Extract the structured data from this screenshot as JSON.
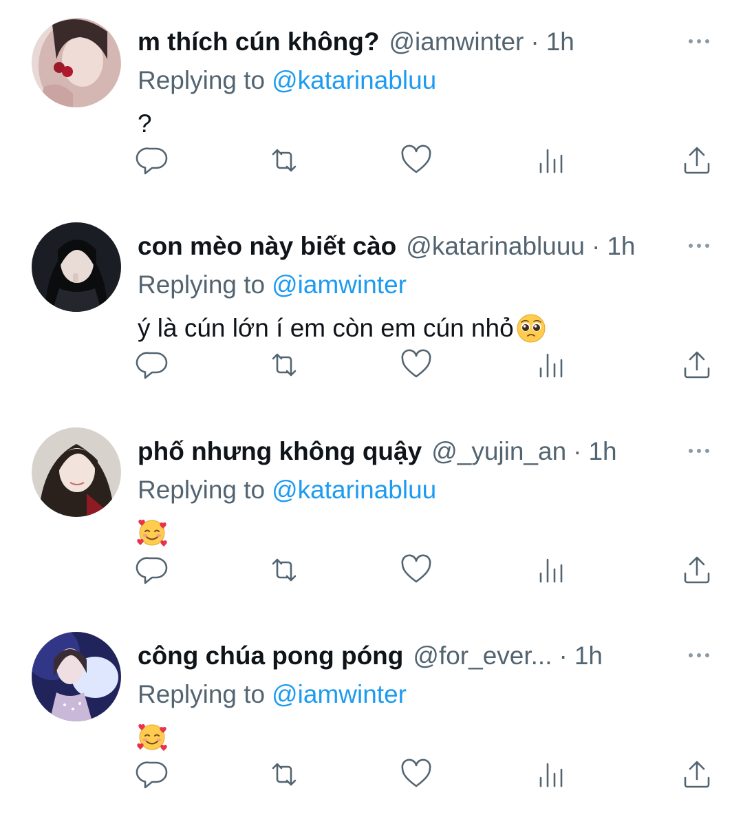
{
  "tweets": [
    {
      "display_name": "m thích cún không?",
      "handle": "@iamwinter",
      "separator": "·",
      "time": "1h",
      "replying_prefix": "Replying to",
      "replying_to": "@katarinabluu",
      "text": "?",
      "emoji": ""
    },
    {
      "display_name": "con mèo này biết cào",
      "handle": "@katarinabluuu",
      "separator": "·",
      "time": "1h",
      "replying_prefix": "Replying to",
      "replying_to": "@iamwinter",
      "text": "ý là cún lớn í em còn em cún nhỏ",
      "emoji": "pleading-face-icon"
    },
    {
      "display_name": "phố nhưng không quậy",
      "handle": "@_yujin_an",
      "separator": "·",
      "time": "1h",
      "replying_prefix": "Replying to",
      "replying_to": "@katarinabluu",
      "text": "",
      "emoji": "smiling-face-with-hearts-icon"
    },
    {
      "display_name": "công chúa pong póng",
      "handle": "@for_ever...",
      "separator": "·",
      "time": "1h",
      "replying_prefix": "Replying to",
      "replying_to": "@iamwinter",
      "text": "",
      "emoji": "smiling-face-with-hearts-icon"
    }
  ],
  "icons": [
    "more-icon",
    "reply-icon",
    "retweet-icon",
    "like-icon",
    "views-icon",
    "share-icon"
  ],
  "colors": {
    "text": "#0f1419",
    "secondary": "#536471",
    "mention": "#1d9bf0",
    "background": "#ffffff"
  }
}
